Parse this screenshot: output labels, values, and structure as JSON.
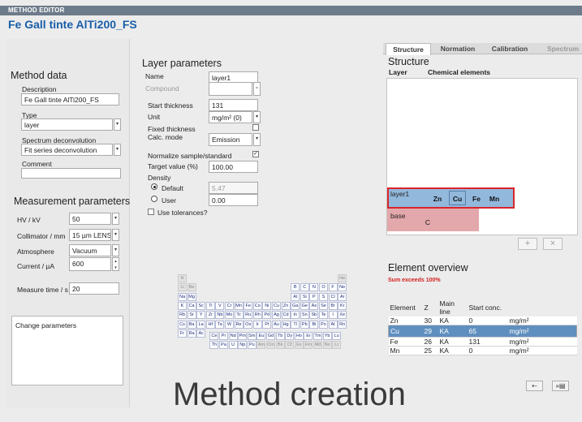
{
  "header": {
    "section_label": "METHOD EDITOR",
    "title": "Fe Gall tinte AlTi200_FS"
  },
  "method_data": {
    "heading": "Method data",
    "description_label": "Description",
    "description_value": "Fe Gall tinte AlTi200_FS",
    "type_label": "Type",
    "type_value": "layer",
    "deconv_label": "Spectrum deconvolution",
    "deconv_value": "Fit series deconvolution",
    "comment_label": "Comment",
    "comment_value": ""
  },
  "measurement": {
    "heading": "Measurement parameters",
    "hv_label": "HV / kV",
    "hv_value": "50",
    "collimator_label": "Collimator / mm",
    "collimator_value": "15 µm LENS",
    "atmosphere_label": "Atmosphere",
    "atmosphere_value": "Vacuum",
    "current_label": "Current / µA",
    "current_value": "600",
    "measure_time_label": "Measure time / s",
    "measure_time_value": "20",
    "change_params_label": "Change parameters"
  },
  "layer_params": {
    "heading": "Layer parameters",
    "name_label": "Name",
    "name_value": "layer1",
    "compound_label": "Compound",
    "compound_value": "",
    "start_thickness_label": "Start thickness",
    "start_thickness_value": "131",
    "unit_label": "Unit",
    "unit_value": "mg/m² (0)",
    "fixed_thickness_label": "Fixed thickness",
    "fixed_thickness_checked": false,
    "calc_mode_label": "Calc. mode",
    "calc_mode_value": "Emission",
    "normalize_label": "Normalize sample/standard",
    "normalize_checked": true,
    "target_label": "Target value (%)",
    "target_value": "100.00",
    "density_label": "Density",
    "default_label": "Default",
    "default_value": "5.47",
    "user_label": "User",
    "user_value": "0.00",
    "tolerances_label": "Use tolerances?"
  },
  "periodic_table": {
    "rows": [
      [
        "H",
        "",
        "",
        "",
        "",
        "",
        "",
        "",
        "",
        "",
        "",
        "",
        "",
        "",
        "",
        "",
        "",
        "He"
      ],
      [
        "Li",
        "Be",
        "",
        "",
        "",
        "",
        "",
        "",
        "",
        "",
        "",
        "",
        "B",
        "C",
        "N",
        "O",
        "F",
        "Ne"
      ],
      [
        "Na",
        "Mg",
        "",
        "",
        "",
        "",
        "",
        "",
        "",
        "",
        "",
        "",
        "Al",
        "Si",
        "P",
        "S",
        "Cl",
        "Ar"
      ],
      [
        "K",
        "Ca",
        "Sc",
        "Ti",
        "V",
        "Cr",
        "Mn",
        "Fe",
        "Co",
        "Ni",
        "Cu",
        "Zn",
        "Ga",
        "Ge",
        "As",
        "Se",
        "Br",
        "Kr"
      ],
      [
        "Rb",
        "Sr",
        "Y",
        "Zr",
        "Nb",
        "Mo",
        "Tc",
        "Ru",
        "Rh",
        "Pd",
        "Ag",
        "Cd",
        "In",
        "Sn",
        "Sb",
        "Te",
        "I",
        "Xe"
      ],
      [
        "Cs",
        "Ba",
        "La",
        "Hf",
        "Ta",
        "W",
        "Re",
        "Os",
        "Ir",
        "Pt",
        "Au",
        "Hg",
        "Tl",
        "Pb",
        "Bi",
        "Po",
        "At",
        "Rn"
      ],
      [
        "Fr",
        "Ra",
        "Ac",
        "",
        "",
        "",
        "",
        "",
        "",
        "",
        "",
        "",
        "",
        "",
        "",
        "",
        "",
        ""
      ]
    ],
    "lanthanides": [
      "Ce",
      "Pr",
      "Nd",
      "Pm",
      "Sm",
      "Eu",
      "Gd",
      "Tb",
      "Dy",
      "Ho",
      "Er",
      "Tm",
      "Yb",
      "Lu"
    ],
    "actinides": [
      "Th",
      "Pa",
      "U",
      "Np",
      "Pu",
      "Am",
      "Cm",
      "Bk",
      "Cf",
      "Es",
      "Fm",
      "Md",
      "No",
      "Lr"
    ],
    "disabled": [
      "H",
      "He",
      "Li",
      "Be",
      "Am",
      "Cm",
      "Bk",
      "Cf",
      "Es",
      "Fm",
      "Md",
      "No",
      "Lr"
    ]
  },
  "caption": "Method creation",
  "tabs": [
    {
      "label": "Structure"
    },
    {
      "label": "Normation"
    },
    {
      "label": "Calibration"
    },
    {
      "label": "Spectrum"
    }
  ],
  "structure": {
    "heading": "Structure",
    "col_layer": "Layer",
    "col_elements": "Chemical elements",
    "layers": [
      {
        "name": "layer1",
        "elements": [
          "Zn",
          "Cu",
          "Fe",
          "Mn"
        ]
      },
      {
        "name": "base",
        "elements": [
          "C"
        ]
      }
    ],
    "add_symbol": "+",
    "remove_symbol": "×"
  },
  "element_overview": {
    "heading": "Element overview",
    "warning": "Sum exceeds 100%",
    "columns": [
      "Element",
      "Z",
      "Main line",
      "Start conc.",
      ""
    ],
    "rows": [
      {
        "element": "Zn",
        "z": "30",
        "line": "KA",
        "conc": "0",
        "unit": "mg/m²"
      },
      {
        "element": "Cu",
        "z": "29",
        "line": "KA",
        "conc": "65",
        "unit": "mg/m²"
      },
      {
        "element": "Fe",
        "z": "26",
        "line": "KA",
        "conc": "131",
        "unit": "mg/m²"
      },
      {
        "element": "Mn",
        "z": "25",
        "line": "KA",
        "conc": "0",
        "unit": "mg/m²"
      }
    ],
    "selected_row": 1
  },
  "nav": {
    "back_symbol": "⇠",
    "save_symbol": "»▤"
  },
  "colors": {
    "title_blue": "#1a5ea8",
    "header_bar": "#6d7b8a",
    "layer1_fill": "#92b8dc",
    "layer1_border": "#d9262c",
    "base_fill": "#e3a8ab",
    "selected_row": "#5f8fbf",
    "warning_red": "#d42020"
  }
}
